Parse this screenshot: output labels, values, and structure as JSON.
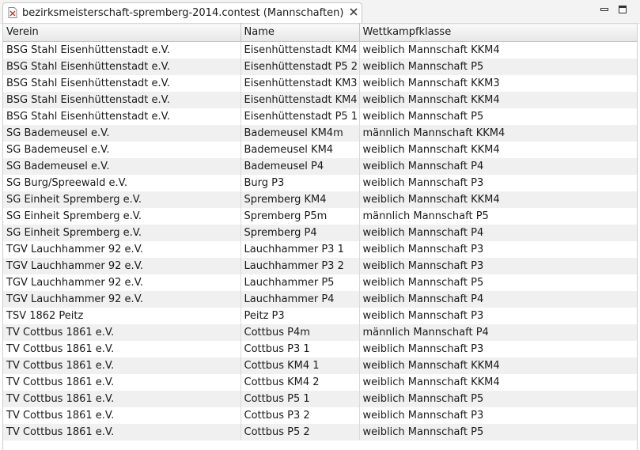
{
  "tab": {
    "title": "bezirksmeisterschaft-spremberg-2014.contest (Mannschaften)"
  },
  "table": {
    "columns": [
      "Verein",
      "Name",
      "Wettkampfklasse"
    ],
    "rows": [
      [
        "BSG Stahl Eisenhüttenstadt e.V.",
        "Eisenhüttenstadt KM4",
        "weiblich Mannschaft KKM4"
      ],
      [
        "BSG Stahl Eisenhüttenstadt e.V.",
        "Eisenhüttenstadt P5 2",
        "weiblich Mannschaft P5"
      ],
      [
        "BSG Stahl Eisenhüttenstadt e.V.",
        "Eisenhüttenstadt KM3",
        "weiblich Mannschaft KKM3"
      ],
      [
        "BSG Stahl Eisenhüttenstadt e.V.",
        "Eisenhüttenstadt KM4",
        "weiblich Mannschaft KKM4"
      ],
      [
        "BSG Stahl Eisenhüttenstadt e.V.",
        "Eisenhüttenstadt P5 1",
        "weiblich Mannschaft P5"
      ],
      [
        "SG Bademeusel e.V.",
        "Bademeusel KM4m",
        "männlich Mannschaft KKM4"
      ],
      [
        "SG Bademeusel e.V.",
        "Bademeusel KM4",
        "weiblich Mannschaft KKM4"
      ],
      [
        "SG Bademeusel e.V.",
        "Bademeusel P4",
        "weiblich Mannschaft P4"
      ],
      [
        "SG Burg/Spreewald e.V.",
        "Burg P3",
        "weiblich Mannschaft P3"
      ],
      [
        "SG Einheit Spremberg e.V.",
        "Spremberg KM4",
        "weiblich Mannschaft KKM4"
      ],
      [
        "SG Einheit Spremberg e.V.",
        "Spremberg P5m",
        "männlich Mannschaft P5"
      ],
      [
        "SG Einheit Spremberg e.V.",
        "Spremberg P4",
        "weiblich Mannschaft P4"
      ],
      [
        "TGV Lauchhammer 92 e.V.",
        "Lauchhammer P3 1",
        "weiblich Mannschaft P3"
      ],
      [
        "TGV Lauchhammer 92 e.V.",
        "Lauchhammer P3 2",
        "weiblich Mannschaft P3"
      ],
      [
        "TGV Lauchhammer 92 e.V.",
        "Lauchhammer P5",
        "weiblich Mannschaft P5"
      ],
      [
        "TGV Lauchhammer 92 e.V.",
        "Lauchhammer P4",
        "weiblich Mannschaft P4"
      ],
      [
        "TSV 1862 Peitz",
        "Peitz P3",
        "weiblich Mannschaft P3"
      ],
      [
        "TV Cottbus 1861 e.V.",
        "Cottbus P4m",
        "männlich Mannschaft P4"
      ],
      [
        "TV Cottbus 1861 e.V.",
        "Cottbus P3 1",
        "weiblich Mannschaft P3"
      ],
      [
        "TV Cottbus 1861 e.V.",
        "Cottbus KM4 1",
        "weiblich Mannschaft KKM4"
      ],
      [
        "TV Cottbus 1861 e.V.",
        "Cottbus KM4 2",
        "weiblich Mannschaft KKM4"
      ],
      [
        "TV Cottbus 1861 e.V.",
        "Cottbus P5 1",
        "weiblich Mannschaft P5"
      ],
      [
        "TV Cottbus 1861 e.V.",
        "Cottbus P3 2",
        "weiblich Mannschaft P3"
      ],
      [
        "TV Cottbus 1861 e.V.",
        "Cottbus P5 2",
        "weiblich Mannschaft P5"
      ]
    ]
  },
  "icons": {
    "tab": "contest-file-icon",
    "close": "close-icon",
    "minimize": "minimize-icon",
    "maximize": "maximize-icon"
  },
  "colors": {
    "row_alt": "#f0f0f0",
    "header_bg": "#e6e6e6"
  }
}
